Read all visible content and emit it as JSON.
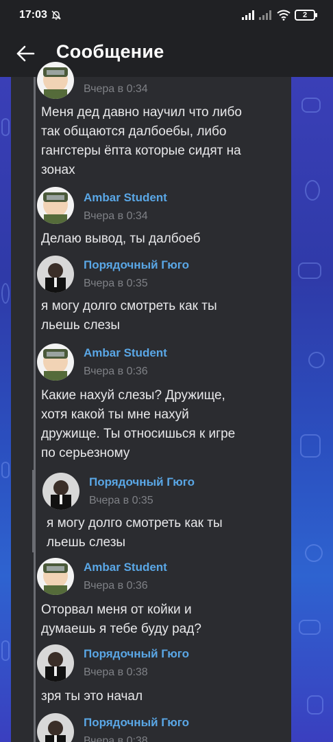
{
  "status_bar": {
    "time": "17:03",
    "battery": "2",
    "icons": [
      "bell-off-icon",
      "signal-icon",
      "signal-icon",
      "wifi-icon",
      "battery-icon"
    ]
  },
  "header": {
    "title": "Сообщение",
    "back_icon": "arrow-left-icon"
  },
  "colors": {
    "header_bg": "#202124",
    "panel_bg": "#2b2c30",
    "author_name": "#5aa7e6",
    "meta": "#7f8186",
    "text": "#e8e8ea",
    "wallpaper": "#3a3fb7"
  },
  "messages": [
    {
      "author": "",
      "avatar": "ambar",
      "date": "Вчера в 0:34",
      "text_lines": [
        "Меня дед давно научил что либо",
        "так общаются далбоебы, либо",
        "гангстеры ёпта которые сидят на",
        "зонах"
      ]
    },
    {
      "author": "Ambar Student",
      "avatar": "ambar",
      "date": "Вчера в 0:34",
      "text_lines": [
        "Делаю вывод, ты далбоеб"
      ]
    },
    {
      "author": "Порядочный Гюго",
      "avatar": "hugo",
      "date": "Вчера в 0:35",
      "text_lines": [
        "я могу долго смотреть как ты",
        "льешь слезы"
      ]
    },
    {
      "author": "Ambar Student",
      "avatar": "ambar",
      "date": "Вчера в 0:36",
      "text_lines": [
        "Какие нахуй слезы? Дружище,",
        "хотя какой ты мне нахуй",
        "дружище. Ты относишься к игре",
        "по серьезному"
      ]
    },
    {
      "author": "Порядочный Гюго",
      "avatar": "hugo",
      "date": "Вчера в 0:35",
      "text_lines": [
        "я могу долго смотреть как ты",
        "льешь слезы"
      ],
      "nested": true
    },
    {
      "author": "Ambar Student",
      "avatar": "ambar",
      "date": "Вчера в 0:36",
      "text_lines": [
        "Оторвал меня от койки и",
        "думаешь я тебе буду рад?"
      ]
    },
    {
      "author": "Порядочный Гюго",
      "avatar": "hugo",
      "date": "Вчера в 0:38",
      "text_lines": [
        "зря ты это начал"
      ]
    },
    {
      "author": "Порядочный Гюго",
      "avatar": "hugo",
      "date": "Вчера в 0:38",
      "text_lines": []
    }
  ]
}
